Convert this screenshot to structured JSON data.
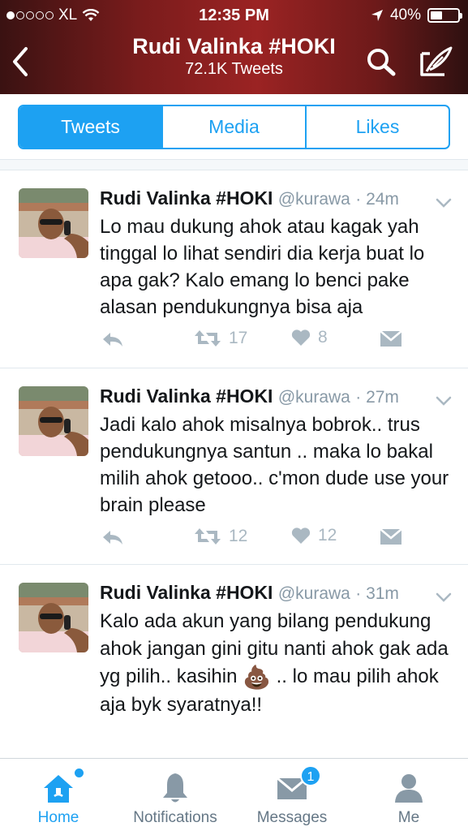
{
  "status_bar": {
    "carrier": "XL",
    "time": "12:35 PM",
    "battery": "40%",
    "battery_level": 0.4,
    "signal_bars_filled": 1
  },
  "header": {
    "title": "Rudi Valinka #HOKI",
    "subtitle": "72.1K Tweets"
  },
  "tabs": [
    {
      "label": "Tweets",
      "selected": true
    },
    {
      "label": "Media",
      "selected": false
    },
    {
      "label": "Likes",
      "selected": false
    }
  ],
  "tweets": [
    {
      "name": "Rudi Valinka #HOKI",
      "handle": "@kurawa",
      "time": "· 24m",
      "text": "Lo mau dukung ahok atau kagak yah tinggal lo lihat sendiri dia kerja buat lo apa gak? Kalo emang lo benci pake alasan pendukungnya bisa aja",
      "retweets": "17",
      "likes": "8"
    },
    {
      "name": "Rudi Valinka #HOKI",
      "handle": "@kurawa",
      "time": "· 27m",
      "text": "Jadi kalo ahok misalnya bobrok.. trus pendukungnya santun .. maka lo bakal milih ahok getooo.. c'mon dude use your brain please",
      "retweets": "12",
      "likes": "12"
    },
    {
      "name": "Rudi Valinka #HOKI",
      "handle": "@kurawa",
      "time": "· 31m",
      "text_before_emoji": "Kalo ada akun yang bilang pendukung ahok jangan gini gitu nanti ahok gak ada yg pilih.. kasihin",
      "emoji": "💩",
      "text_after_emoji": " .. lo mau pilih ahok aja byk syaratnya!!"
    }
  ],
  "tabbar": [
    {
      "label": "Home",
      "icon": "home-icon",
      "active": true
    },
    {
      "label": "Notifications",
      "icon": "bell-icon",
      "active": false
    },
    {
      "label": "Messages",
      "icon": "envelope-icon",
      "badge": "1",
      "active": false
    },
    {
      "label": "Me",
      "icon": "person-icon",
      "active": false
    }
  ],
  "colors": {
    "accent": "#1da1f2",
    "header_red": "#9b2323",
    "meta_gray": "#8899a6"
  }
}
